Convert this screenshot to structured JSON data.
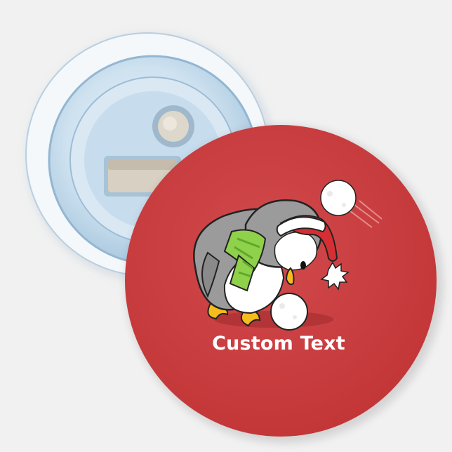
{
  "product": {
    "custom_text": "Custom Text"
  },
  "colors": {
    "background": "#f1f1f1",
    "button_face": "#c93d3f",
    "penguin_body": "#9b9b9b",
    "scarf": "#8fd14a",
    "hat": "#d62f33",
    "beak_feet": "#f6bb1c",
    "snow": "#ffffff"
  },
  "icons": [
    "bottle-opener-back",
    "penguin-illustration",
    "snowball-icon",
    "santa-hat-icon"
  ]
}
